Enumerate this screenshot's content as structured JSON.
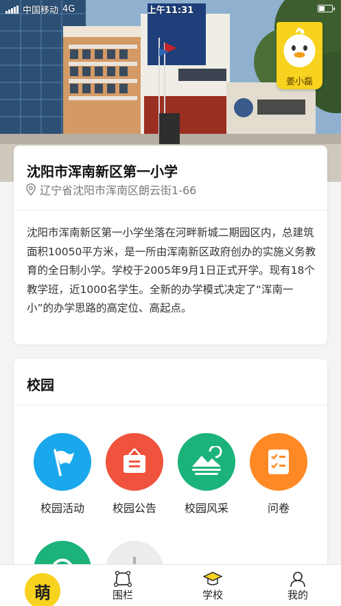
{
  "status_bar": {
    "carrier": "中国移动",
    "network": "4G",
    "time": "上午11:31"
  },
  "mascot": {
    "name": "姜小磊",
    "icon": "duck-mascot-icon",
    "color": "#f7d21e"
  },
  "school": {
    "name": "沈阳市浑南新区第一小学",
    "address": "辽宁省沈阳市浑南区朗云街1-66",
    "address_icon": "location-pin-icon",
    "description": "沈阳市浑南新区第一小学坐落在河畔新城二期园区内，总建筑面积10050平方米，是一所由浑南新区政府创办的实施义务教育的全日制小学。学校于2005年9月1日正式开学。现有18个教学班，近1000名学生。全新的办学模式决定了“浑南一小”的办学思路的高定位、高起点。"
  },
  "campus": {
    "title": "校园",
    "items": [
      {
        "label": "校园活动",
        "icon": "flag-icon",
        "color": "#1aa7ec"
      },
      {
        "label": "校园公告",
        "icon": "notice-board-icon",
        "color": "#f0533d"
      },
      {
        "label": "校园风采",
        "icon": "landscape-icon",
        "color": "#1bb37a"
      },
      {
        "label": "问卷",
        "icon": "checklist-icon",
        "color": "#ff8a25"
      },
      {
        "label": "",
        "icon": "green-round-icon",
        "color": "#1bb37a"
      },
      {
        "label": "",
        "icon": "gray-round-icon",
        "color": "#ececec"
      }
    ]
  },
  "bottom_nav": {
    "home_badge": "萌",
    "items": [
      {
        "label": "围栏",
        "icon": "fence-icon"
      },
      {
        "label": "学校",
        "icon": "graduation-cap-icon"
      },
      {
        "label": "我的",
        "icon": "user-icon"
      }
    ]
  }
}
